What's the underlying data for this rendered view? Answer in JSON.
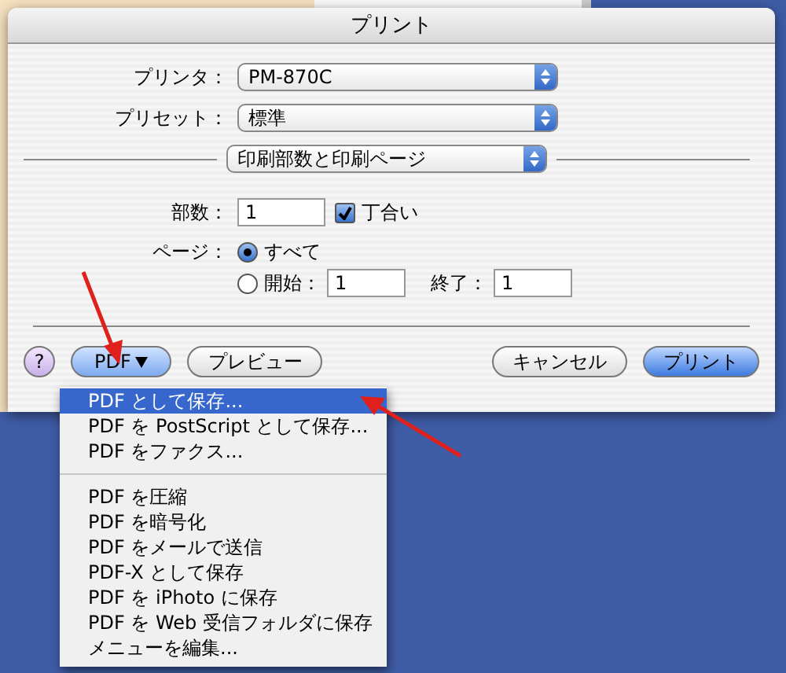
{
  "window": {
    "title": "プリント"
  },
  "printer": {
    "label": "プリンタ：",
    "value": "PM-870C"
  },
  "preset": {
    "label": "プリセット：",
    "value": "標準"
  },
  "panel_menu": {
    "value": "印刷部数と印刷ページ"
  },
  "copies": {
    "label": "部数：",
    "value": "1",
    "collated": {
      "label": "丁合い",
      "checked": true
    }
  },
  "pages": {
    "label": "ページ：",
    "options": [
      {
        "label": "すべて",
        "selected": true
      },
      {
        "label": "開始：",
        "selected": false
      }
    ],
    "from": "1",
    "to_label": "終了：",
    "to": "1"
  },
  "buttons": [
    {
      "kind": "help",
      "label": "?"
    },
    {
      "kind": "menu",
      "label": "PDF"
    },
    {
      "kind": "push",
      "label": "プレビュー"
    },
    {
      "kind": "push",
      "label": "キャンセル"
    },
    {
      "kind": "default",
      "label": "プリント"
    }
  ],
  "pdf_menu": {
    "groups": [
      [
        {
          "label": "PDF として保存...",
          "selected": true
        },
        {
          "label": "PDF を PostScript として保存...",
          "selected": false
        },
        {
          "label": "PDF をファクス...",
          "selected": false
        }
      ],
      [
        {
          "label": "PDF を圧縮",
          "selected": false
        },
        {
          "label": "PDF を暗号化",
          "selected": false
        },
        {
          "label": "PDF をメールで送信",
          "selected": false
        },
        {
          "label": "PDF-X として保存",
          "selected": false
        },
        {
          "label": "PDF を iPhoto に保存",
          "selected": false
        },
        {
          "label": "PDF を Web 受信フォルダに保存",
          "selected": false
        },
        {
          "label": "メニューを編集...",
          "selected": false
        }
      ]
    ]
  }
}
